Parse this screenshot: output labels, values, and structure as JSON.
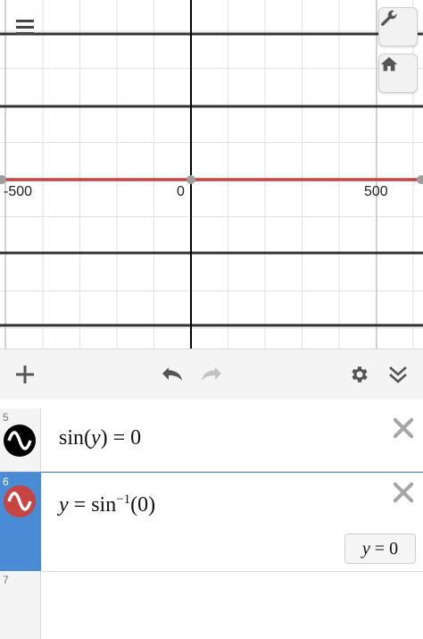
{
  "graph": {
    "x_tick_labels": [
      "-500",
      "0",
      "500"
    ],
    "curve_color": "#c74440",
    "axis_color": "#000000"
  },
  "controls": {
    "menu_icon": "hamburger-menu-icon",
    "settings_icon": "wrench-icon",
    "home_icon": "home-icon"
  },
  "toolbar": {
    "add_icon": "plus-icon",
    "undo_icon": "undo-icon",
    "redo_icon": "redo-icon",
    "gear_icon": "gear-icon",
    "collapse_icon": "double-chevron-down-icon"
  },
  "expressions": [
    {
      "number": "5",
      "color": "#000000",
      "prefix": "sin(",
      "var": "y",
      "suffix": ") = 0",
      "selected": false
    },
    {
      "number": "6",
      "color": "#c74440",
      "lhs": "y",
      "op": " = sin",
      "sup": "−1",
      "arg": "(0)",
      "eval_var": "y",
      "eval_val": "=  0",
      "selected": true
    },
    {
      "number": "7"
    }
  ]
}
